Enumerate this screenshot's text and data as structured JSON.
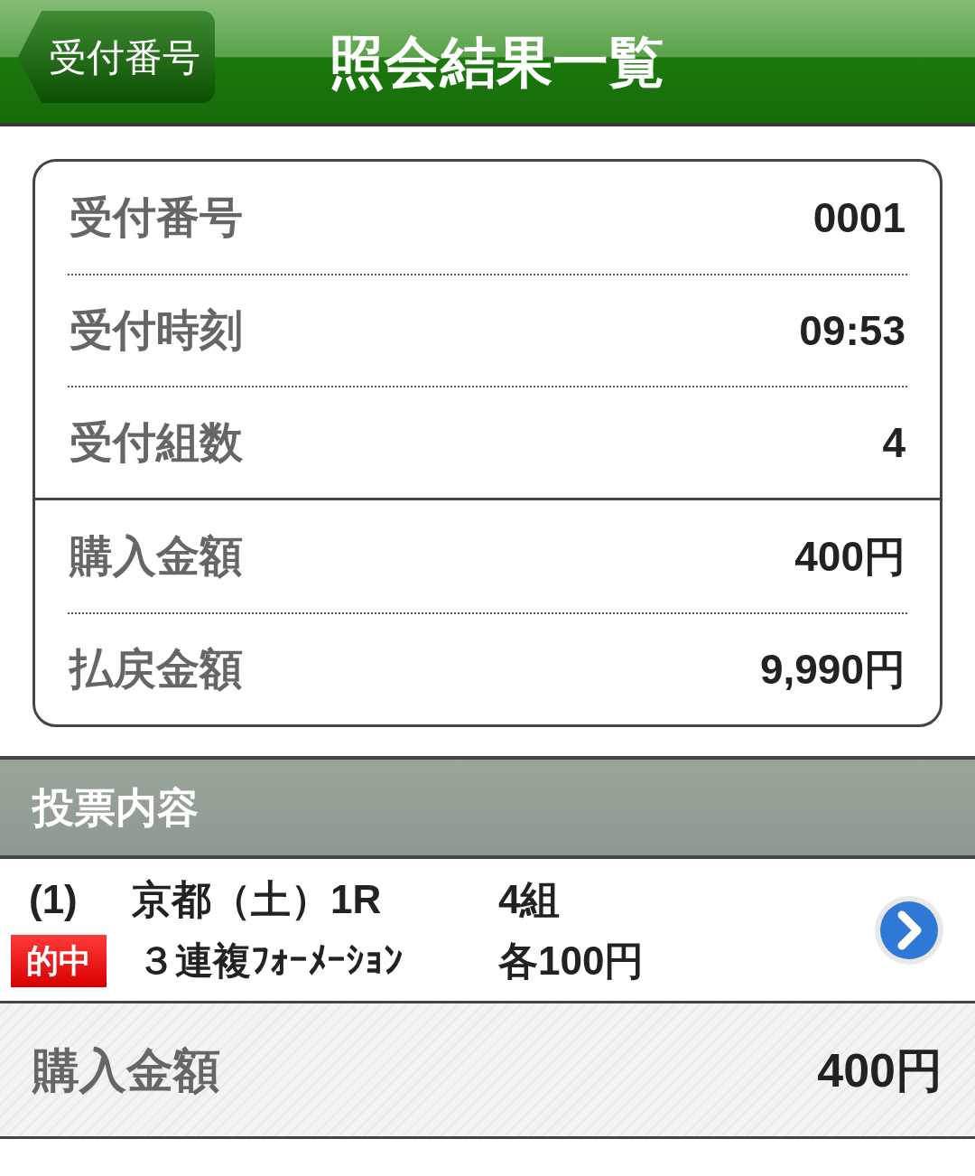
{
  "header": {
    "back_button": "受付番号",
    "title": "照会結果一覧"
  },
  "summary": {
    "sections": [
      [
        {
          "label": "受付番号",
          "value": "0001"
        },
        {
          "label": "受付時刻",
          "value": "09:53"
        },
        {
          "label": "受付組数",
          "value": "4"
        }
      ],
      [
        {
          "label": "購入金額",
          "value": "400円"
        },
        {
          "label": "払戻金額",
          "value": "9,990円"
        }
      ]
    ]
  },
  "section_title": "投票内容",
  "bets": [
    {
      "number": "(1)",
      "race": "京都（土）1R",
      "combinations": "4組",
      "hit": true,
      "badge": "的中",
      "bet_type": "３連複ﾌｫｰﾒｰｼｮﾝ",
      "amount": "各100円"
    }
  ],
  "total": {
    "label": "購入金額",
    "value": "400円"
  }
}
